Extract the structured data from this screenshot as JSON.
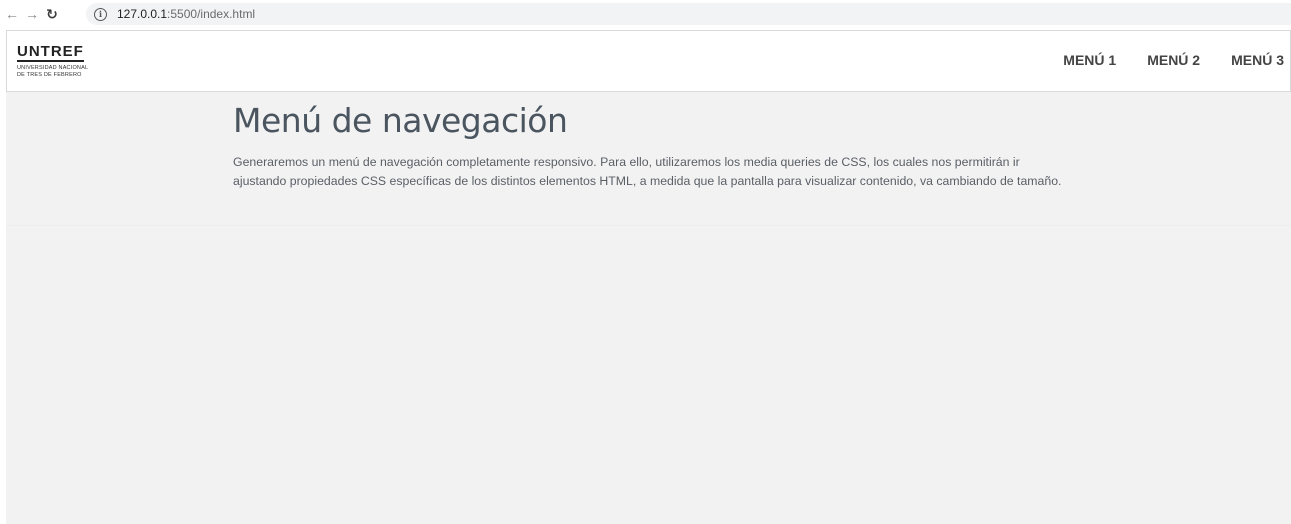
{
  "browser": {
    "url_host": "127.0.0.1",
    "url_rest": ":5500/index.html",
    "info_icon": "info-icon",
    "back_icon": "arrow-left-icon",
    "forward_icon": "arrow-right-icon",
    "reload_icon": "reload-icon"
  },
  "header": {
    "logo_word": "UNTREF",
    "logo_line1": "UNIVERSIDAD NACIONAL",
    "logo_line2": "DE TRES DE FEBRERO",
    "menu": [
      {
        "label": "MENÚ 1"
      },
      {
        "label": "MENÚ 2"
      },
      {
        "label": "MENÚ 3"
      }
    ]
  },
  "main": {
    "title": "Menú de navegación",
    "paragraph_line1": "Generaremos un menú de navegación completamente responsivo. Para ello, utilizaremos los media queries de CSS, los cuales nos permitirán ir",
    "paragraph_line2": "ajustando propiedades CSS específicas de los distintos elementos HTML, a medida que la pantalla para visualizar contenido, va cambiando de tamaño."
  },
  "colors": {
    "page_background": "#f2f2f2",
    "header_background": "#ffffff",
    "title_color": "#4a5560",
    "menu_color": "#444444"
  }
}
